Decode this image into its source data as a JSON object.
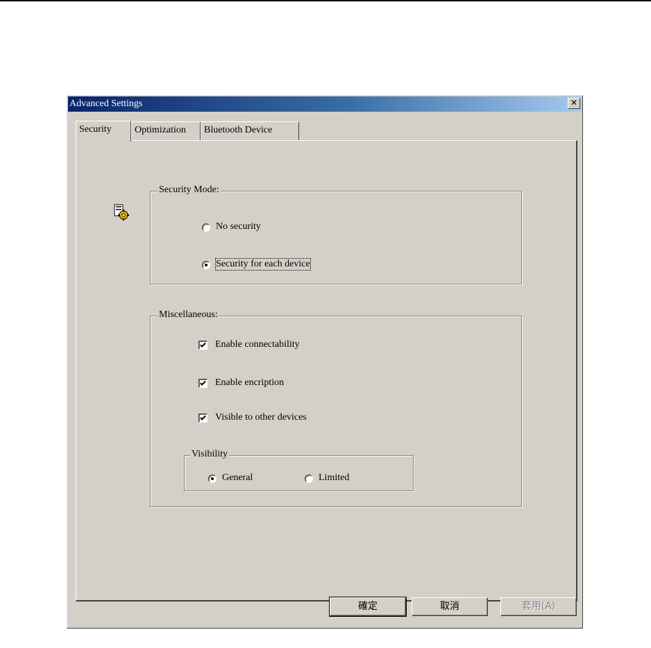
{
  "window": {
    "title": "Advanced Settings",
    "close_glyph": "✕"
  },
  "tabs": [
    {
      "label": "Security",
      "active": true
    },
    {
      "label": "Optimization",
      "active": false
    },
    {
      "label": "Bluetooth Device",
      "active": false
    }
  ],
  "icon": "settings-gear-icon",
  "security_mode": {
    "legend": "Security Mode:",
    "options": [
      {
        "label": "No security",
        "selected": false
      },
      {
        "label": "Security for each device",
        "selected": true
      }
    ]
  },
  "miscellaneous": {
    "legend": "Miscellaneous:",
    "checkboxes": [
      {
        "label": "Enable connectability",
        "checked": true
      },
      {
        "label": "Enable encription",
        "checked": true
      },
      {
        "label": "Visible to other devices",
        "checked": true
      }
    ],
    "visibility": {
      "legend": "Visibility",
      "options": [
        {
          "label": "General",
          "selected": true
        },
        {
          "label": "Limited",
          "selected": false
        }
      ]
    }
  },
  "buttons": {
    "ok": "確定",
    "cancel": "取消",
    "apply": "套用(A)"
  },
  "colors": {
    "dialog_bg": "#d4d0c8",
    "title_start": "#0a246a",
    "title_end": "#a6caf0"
  }
}
